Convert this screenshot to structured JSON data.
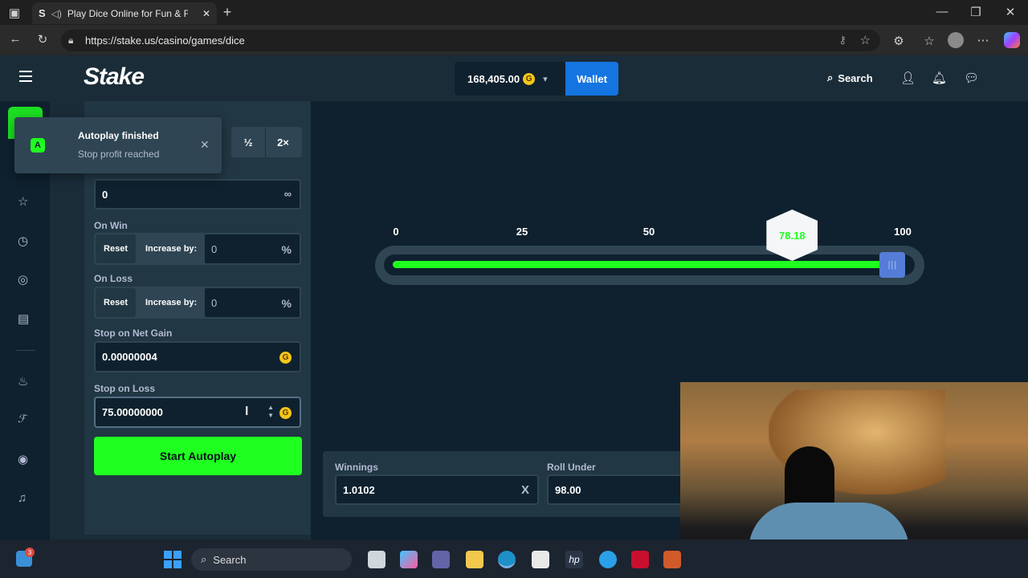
{
  "browser": {
    "tab_title": "Play Dice Online for Fun & F",
    "url": "https://stake.us/casino/games/dice"
  },
  "header": {
    "logo": "Stake",
    "balance": "168,405.00",
    "wallet_label": "Wallet",
    "search_label": "Search"
  },
  "toast": {
    "title": "Autoplay finished",
    "message": "Stop profit reached",
    "half_label": "½",
    "double_label": "2×"
  },
  "form": {
    "games_value": "0",
    "on_win": {
      "label": "On Win",
      "reset": "Reset",
      "increase": "Increase by:",
      "value": "0",
      "unit": "%"
    },
    "on_loss": {
      "label": "On Loss",
      "reset": "Reset",
      "increase": "Increase by:",
      "value": "0",
      "unit": "%"
    },
    "stop_net_gain": {
      "label": "Stop on Net Gain",
      "value": "0.00000004"
    },
    "stop_loss": {
      "label": "Stop on Loss",
      "value": "75.00000000"
    },
    "start_button": "Start Autoplay"
  },
  "slider": {
    "ticks": [
      "0",
      "25",
      "50",
      "100"
    ],
    "result": "78.18",
    "roll_under": 98
  },
  "stats": {
    "winnings_label": "Winnings",
    "winnings_value": "1.0102",
    "winnings_unit": "X",
    "roll_under_label": "Roll Under",
    "roll_under_value": "98.00"
  },
  "taskbar": {
    "search": "Search",
    "badge": "3"
  },
  "colors": {
    "accent_green": "#1fff20",
    "wallet_blue": "#1475e1",
    "bg": "#1a2c38"
  }
}
